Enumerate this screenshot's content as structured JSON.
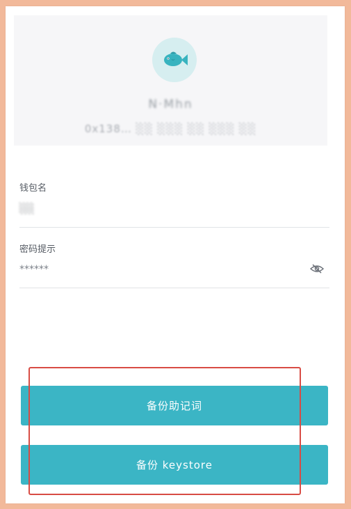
{
  "profile": {
    "avatar_icon": "fish-icon",
    "name": "N·Mhn",
    "address": "0x138… ░░ ░░░ ░░ ░░░ ░░"
  },
  "fields": {
    "wallet_name_label": "钱包名",
    "wallet_name_value": "░░",
    "password_hint_label": "密码提示",
    "password_hint_value": "******",
    "visibility_icon": "eye-hidden-icon"
  },
  "buttons": {
    "backup_mnemonic": "备份助记词",
    "backup_keystore": "备份 keystore"
  },
  "colors": {
    "accent": "#3bb5c5",
    "highlight_border": "#d84c44"
  }
}
